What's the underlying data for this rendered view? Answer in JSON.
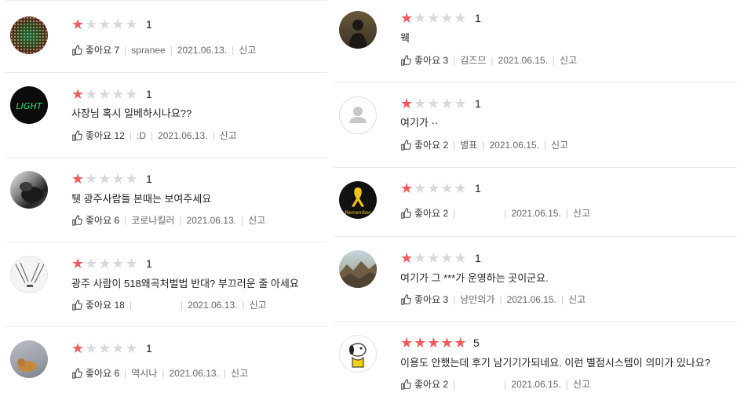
{
  "left_reviews": [
    {
      "score": "1",
      "body": "",
      "likes": "좋아요 7",
      "user": "spranee",
      "date": "2021.06.13.",
      "report": "신고"
    },
    {
      "score": "1",
      "body": "사장님 혹시 일베하시나요??",
      "likes": "좋아요 12",
      "user": ":D",
      "date": "2021.06.13.",
      "report": "신고"
    },
    {
      "score": "1",
      "body": "퉷  광주사람들 본때는 보여주세요",
      "likes": "좋아요 6",
      "user": "코로나킬러",
      "date": "2021.06.13.",
      "report": "신고"
    },
    {
      "score": "1",
      "body": "광주 사람이 518왜곡처벌법 반대? 부끄러운 줄 아세요",
      "likes": "좋아요 18",
      "user": "",
      "date": "2021.06.13.",
      "report": "신고"
    },
    {
      "score": "1",
      "body": "",
      "likes": "좋아요 6",
      "user": "역시나",
      "date": "2021.06.13.",
      "report": "신고"
    }
  ],
  "right_reviews": [
    {
      "score": "1",
      "body": "웩",
      "likes": "좋아요 3",
      "user": "김즈므",
      "date": "2021.06.15.",
      "report": "신고"
    },
    {
      "score": "1",
      "body": "여기가 ··",
      "likes": "좋아요 2",
      "user": "별표",
      "date": "2021.06.15.",
      "report": "신고"
    },
    {
      "score": "1",
      "body": "",
      "likes": "좋아요 2",
      "user": "",
      "date": "2021.06.15.",
      "report": "신고"
    },
    {
      "score": "1",
      "body": "여기가 그 ***가 운영하는 곳이군요.",
      "likes": "좋아요 3",
      "user": "낭만의가",
      "date": "2021.06.15.",
      "report": "신고"
    },
    {
      "score": "5",
      "body": "이용도 안했는데 후기 남기기가되네요. 이런 별점시스템이 의미가 있나요?",
      "likes": "좋아요 2",
      "user": "",
      "date": "2021.06.15.",
      "report": "신고"
    }
  ],
  "avatar_labels": {
    "light": "LIGHT",
    "remember": "Remember"
  },
  "colors": {
    "star_on": "#f25b5b",
    "star_off": "#d9d9d9"
  }
}
